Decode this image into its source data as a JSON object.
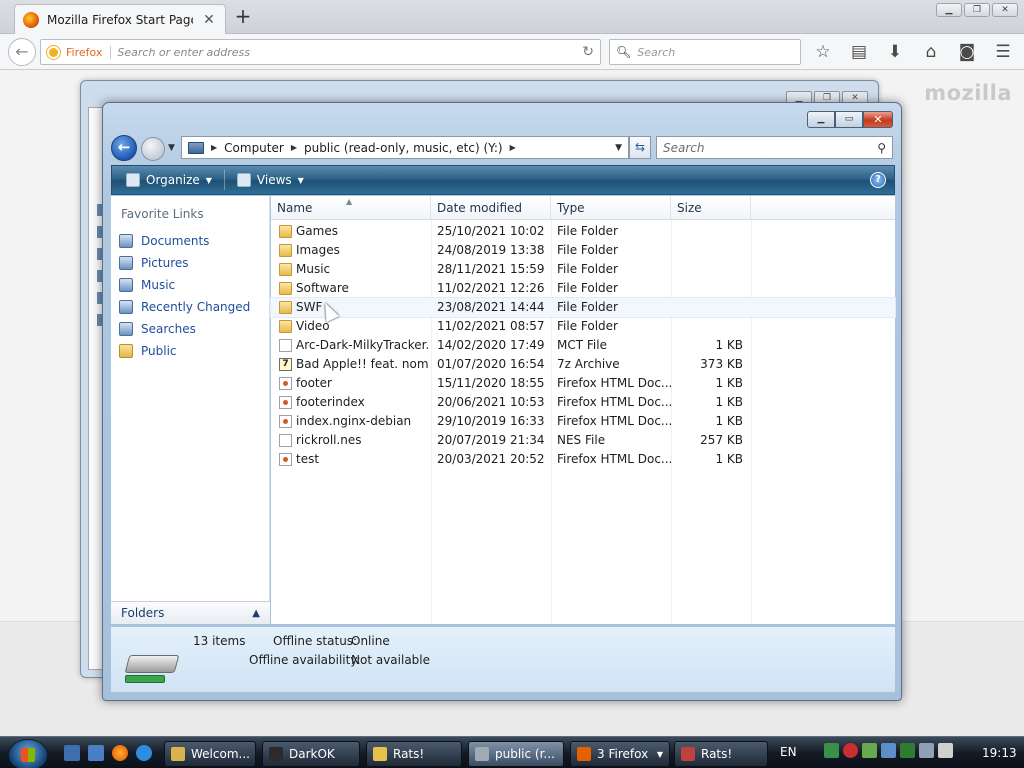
{
  "firefox": {
    "tab_title": "Mozilla Firefox Start Page",
    "url_label": "Firefox",
    "url_placeholder": "Search or enter address",
    "search_placeholder": "Search",
    "brand_watermark": "mozilla"
  },
  "explorer": {
    "breadcrumbs": [
      "Computer",
      "public (read-only, music, etc) (Y:)"
    ],
    "search_placeholder": "Search",
    "toolbar": {
      "organize": "Organize",
      "views": "Views"
    },
    "nav": {
      "heading": "Favorite Links",
      "items": [
        {
          "label": "Documents",
          "icon": "documents-icon"
        },
        {
          "label": "Pictures",
          "icon": "pictures-icon"
        },
        {
          "label": "Music",
          "icon": "music-icon"
        },
        {
          "label": "Recently Changed",
          "icon": "recent-icon"
        },
        {
          "label": "Searches",
          "icon": "searches-icon"
        },
        {
          "label": "Public",
          "icon": "folder-icon"
        }
      ],
      "folders_label": "Folders"
    },
    "columns": {
      "name": "Name",
      "date": "Date modified",
      "type": "Type",
      "size": "Size"
    },
    "files": [
      {
        "name": "Games",
        "date": "25/10/2021 10:02",
        "type": "File Folder",
        "size": "",
        "icon": "folder"
      },
      {
        "name": "Images",
        "date": "24/08/2019 13:38",
        "type": "File Folder",
        "size": "",
        "icon": "folder"
      },
      {
        "name": "Music",
        "date": "28/11/2021 15:59",
        "type": "File Folder",
        "size": "",
        "icon": "folder"
      },
      {
        "name": "Software",
        "date": "11/02/2021 12:26",
        "type": "File Folder",
        "size": "",
        "icon": "folder"
      },
      {
        "name": "SWF",
        "date": "23/08/2021 14:44",
        "type": "File Folder",
        "size": "",
        "icon": "folder"
      },
      {
        "name": "Video",
        "date": "11/02/2021 08:57",
        "type": "File Folder",
        "size": "",
        "icon": "folder"
      },
      {
        "name": "Arc-Dark-MilkyTracker...",
        "date": "14/02/2020 17:49",
        "type": "MCT File",
        "size": "1 KB",
        "icon": "file"
      },
      {
        "name": "Bad Apple!! feat. nomi...",
        "date": "01/07/2020 16:54",
        "type": "7z Archive",
        "size": "373 KB",
        "icon": "archive"
      },
      {
        "name": "footer",
        "date": "15/11/2020 18:55",
        "type": "Firefox HTML Doc...",
        "size": "1 KB",
        "icon": "html"
      },
      {
        "name": "footerindex",
        "date": "20/06/2021 10:53",
        "type": "Firefox HTML Doc...",
        "size": "1 KB",
        "icon": "html"
      },
      {
        "name": "index.nginx-debian",
        "date": "29/10/2019 16:33",
        "type": "Firefox HTML Doc...",
        "size": "1 KB",
        "icon": "html"
      },
      {
        "name": "rickroll.nes",
        "date": "20/07/2019 21:34",
        "type": "NES File",
        "size": "257 KB",
        "icon": "file"
      },
      {
        "name": "test",
        "date": "20/03/2021 20:52",
        "type": "Firefox HTML Doc...",
        "size": "1 KB",
        "icon": "html"
      }
    ],
    "details": {
      "items_count": "13 items",
      "offline_status_label": "Offline status:",
      "offline_status_value": "Online",
      "offline_availability_label": "Offline availability:",
      "offline_availability_value": "Not available"
    }
  },
  "taskbar": {
    "buttons": [
      {
        "label": "Welcom...",
        "icon_color": "#d9b44a"
      },
      {
        "label": "DarkOK",
        "icon_color": "#2b2b2b"
      },
      {
        "label": "Rats!",
        "icon_color": "#e6c24a"
      },
      {
        "label": "public (r...",
        "icon_color": "#a0a9b4"
      },
      {
        "label": "3 Firefox",
        "icon_color": "#e66000"
      },
      {
        "label": "Rats!",
        "icon_color": "#c04040"
      }
    ],
    "language": "EN",
    "clock": "19:13"
  }
}
